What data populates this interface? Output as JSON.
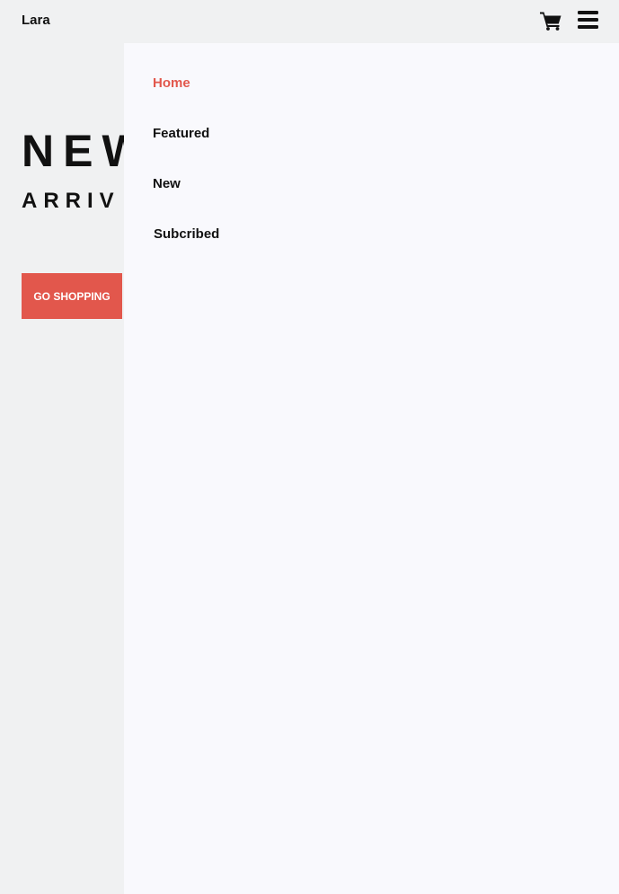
{
  "header": {
    "brand": "Lara",
    "cart_icon": "shopping-cart-icon",
    "menu_icon": "hamburger-menu-icon"
  },
  "hero": {
    "title": "NEW",
    "subtitle": "ARRIV",
    "cta_label": "GO SHOPPING"
  },
  "drawer": {
    "items": [
      {
        "label": "Home",
        "active": true
      },
      {
        "label": "Featured",
        "active": false
      },
      {
        "label": "New",
        "active": false
      },
      {
        "label": "Subcribed",
        "active": false
      }
    ]
  },
  "colors": {
    "accent": "#e2574c",
    "page_background": "#f0f1f2",
    "drawer_background": "#f9f9fd",
    "text": "#111111"
  }
}
